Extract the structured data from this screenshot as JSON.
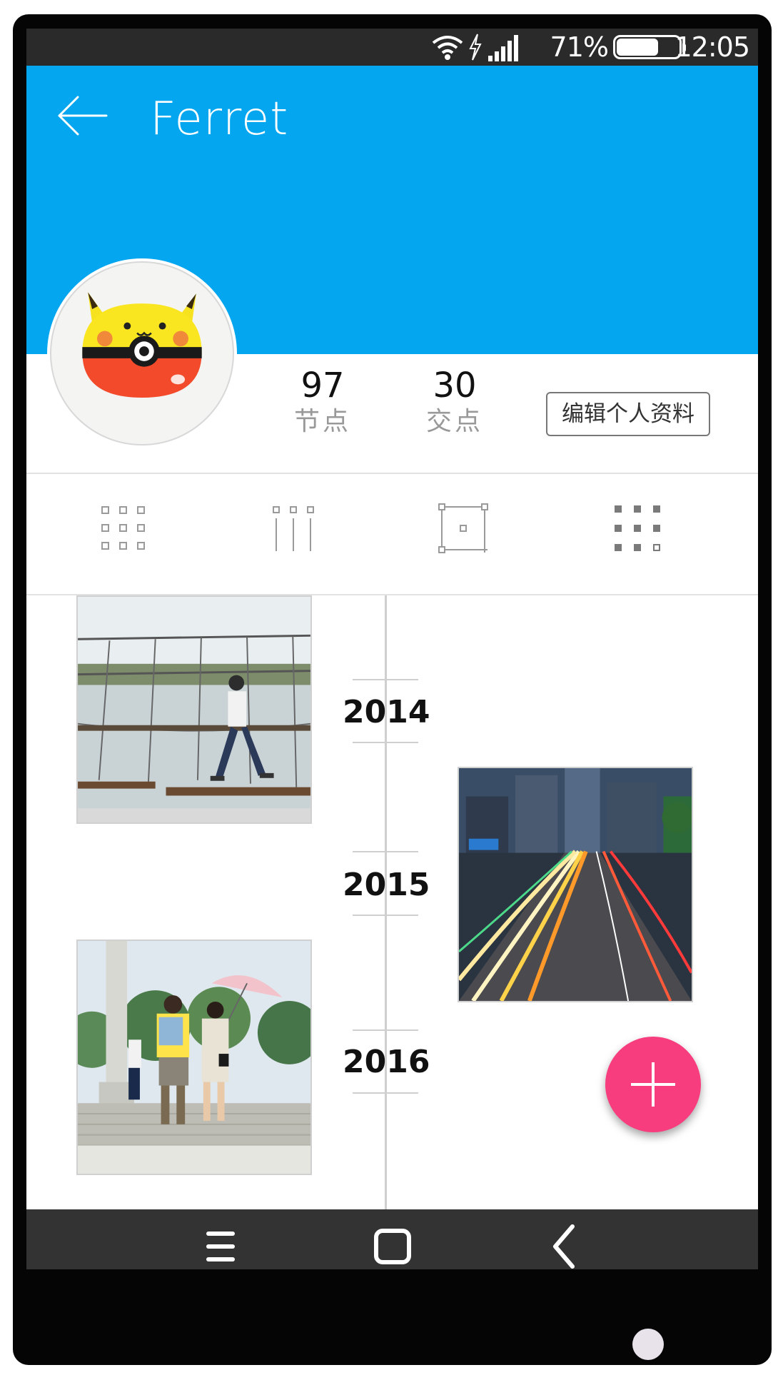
{
  "status_bar": {
    "battery_percent": "71%",
    "battery_level": 0.71,
    "time": "12:05",
    "icons": [
      "wifi-icon",
      "charging-icon",
      "signal-icon",
      "battery-icon"
    ]
  },
  "header": {
    "title": "Ferret",
    "back_icon": "arrow-left-icon",
    "background_color": "#03a6ef"
  },
  "profile": {
    "avatar": "pikachu-pokeball-avatar",
    "stats": [
      {
        "value": "97",
        "label": "节点"
      },
      {
        "value": "30",
        "label": "交点"
      }
    ],
    "edit_button_label": "编辑个人资料"
  },
  "view_modes": [
    {
      "name": "grid",
      "icon": "grid-3x3-icon"
    },
    {
      "name": "columns",
      "icon": "columns-icon"
    },
    {
      "name": "frame",
      "icon": "frame-icon"
    },
    {
      "name": "dots",
      "icon": "dots-grid-icon"
    }
  ],
  "timeline": {
    "years": [
      "2014",
      "2015",
      "2016"
    ],
    "photos": [
      {
        "description": "person-on-rope-bridge-photo"
      },
      {
        "description": "city-traffic-light-trails-photo"
      },
      {
        "description": "couple-with-umbrella-photo"
      }
    ]
  },
  "fab": {
    "icon": "plus-icon",
    "color": "#f83d7e"
  },
  "nav_bar": {
    "buttons": [
      "menu-icon",
      "home-square-icon",
      "back-chevron-icon"
    ]
  }
}
